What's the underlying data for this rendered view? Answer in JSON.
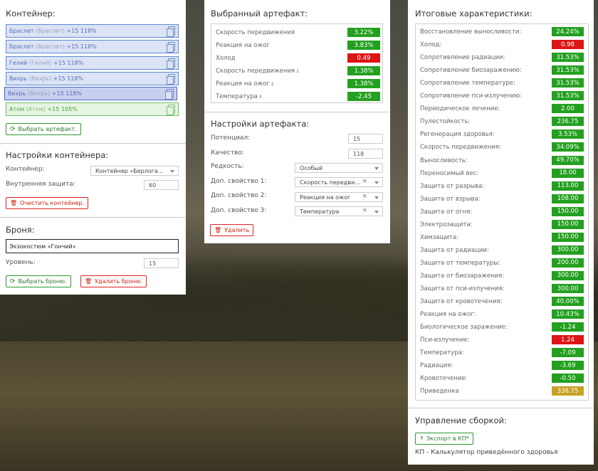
{
  "container": {
    "title": "Контейнер:",
    "items": [
      {
        "name": "Браслет",
        "alias": "(Браслет)",
        "bonus": "+15 118%"
      },
      {
        "name": "Браслет",
        "alias": "(Браслет)",
        "bonus": "+15 118%"
      },
      {
        "name": "Гелий",
        "alias": "(Гелий)",
        "bonus": "+15 118%"
      },
      {
        "name": "Вихрь",
        "alias": "(Вихрь)",
        "bonus": "+15 118%"
      },
      {
        "name": "Вихрь",
        "alias": "(Вихрь)",
        "bonus": "+15 118%"
      },
      {
        "name": "Атом",
        "alias": "(Атом)",
        "bonus": "+15 105%"
      }
    ],
    "choose_btn": "Выбрать артефакт."
  },
  "container_settings": {
    "title": "Настройки контейнера:",
    "container_label": "Контейнер:",
    "container_value": "Контейнер «Берлога...",
    "protection_label": "Внутренняя защита:",
    "protection_value": "60",
    "clear_btn": "Очистить контейнер."
  },
  "armor": {
    "title": "Броня:",
    "value": "Экзокостюм «Гончий»",
    "level_label": "Уровень:",
    "level_value": "15",
    "choose_btn": "Выбрать броню.",
    "delete_btn": "Удалить броню."
  },
  "selected": {
    "title": "Выбранный артефакт:",
    "rows": [
      {
        "label": "Скорость передвижения",
        "sup": "",
        "value": "3.22%",
        "color": "#23a01f"
      },
      {
        "label": "Реакция на ожог",
        "sup": "",
        "value": "3.83%",
        "color": "#23a01f"
      },
      {
        "label": "Холод",
        "sup": "",
        "value": "0.49",
        "color": "#dd1515"
      },
      {
        "label": "Скорость передвижения",
        "sup": "1",
        "value": "1.38%",
        "color": "#23a01f"
      },
      {
        "label": "Реакция на ожог",
        "sup": "2",
        "value": "1.38%",
        "color": "#23a01f"
      },
      {
        "label": "Температура",
        "sup": "3",
        "value": "-2.45",
        "color": "#23a01f"
      }
    ]
  },
  "art_settings": {
    "title": "Настройки артефакта:",
    "potential_label": "Потенциал:",
    "potential_value": "15",
    "quality_label": "Качество:",
    "quality_value": "118",
    "rarity_label": "Редкость:",
    "rarity_value": "Особый",
    "prop1_label": "Доп. свойство 1:",
    "prop1_value": "Скорость передви...",
    "prop2_label": "Доп. свойство 2:",
    "prop2_value": "Реакция на ожог",
    "prop3_label": "Доп. свойство 3:",
    "prop3_value": "Температура",
    "delete_btn": "Удалить"
  },
  "totals": {
    "title": "Итоговые характеристики:",
    "rows": [
      {
        "label": "Восстановление выносливости:",
        "value": "24.24%",
        "color": "#23a01f"
      },
      {
        "label": "Холод:",
        "value": "0.98",
        "color": "#dd1515"
      },
      {
        "label": "Сопротивление радиации:",
        "value": "31.53%",
        "color": "#23a01f"
      },
      {
        "label": "Сопротивление биозаражению:",
        "value": "31.53%",
        "color": "#23a01f"
      },
      {
        "label": "Сопротивление температуре:",
        "value": "31.53%",
        "color": "#23a01f"
      },
      {
        "label": "Сопротивление пси-излучению:",
        "value": "31.53%",
        "color": "#23a01f"
      },
      {
        "label": "Периодическое лечение:",
        "value": "2.00",
        "color": "#23a01f"
      },
      {
        "label": "Пулестойкость:",
        "value": "236.75",
        "color": "#23a01f"
      },
      {
        "label": "Регенерация здоровья:",
        "value": "3.53%",
        "color": "#23a01f"
      },
      {
        "label": "Скорость передвижения:",
        "value": "34.09%",
        "color": "#23a01f"
      },
      {
        "label": "Выносливость:",
        "value": "49.70%",
        "color": "#23a01f"
      },
      {
        "label": "Переносимый вес:",
        "value": "18.00",
        "color": "#23a01f"
      },
      {
        "label": "Защита от разрыва:",
        "value": "113.00",
        "color": "#23a01f"
      },
      {
        "label": "Защита от взрыва:",
        "value": "108.00",
        "color": "#23a01f"
      },
      {
        "label": "Защита от огня:",
        "value": "150.00",
        "color": "#23a01f"
      },
      {
        "label": "Электрозащита:",
        "value": "150.00",
        "color": "#23a01f"
      },
      {
        "label": "Химзащита:",
        "value": "150.00",
        "color": "#23a01f"
      },
      {
        "label": "Защита от радиации:",
        "value": "300.00",
        "color": "#23a01f"
      },
      {
        "label": "Защита от температуры:",
        "value": "200.00",
        "color": "#23a01f"
      },
      {
        "label": "Защита от биозаражения:",
        "value": "300.00",
        "color": "#23a01f"
      },
      {
        "label": "Защита от пси-излучения:",
        "value": "300.00",
        "color": "#23a01f"
      },
      {
        "label": "Защита от кровотечения:",
        "value": "40.00%",
        "color": "#23a01f"
      },
      {
        "label": "Реакция на ожог:",
        "value": "10.43%",
        "color": "#23a01f"
      },
      {
        "label": "Биологическое заражение:",
        "value": "-1.24",
        "color": "#23a01f"
      },
      {
        "label": "Пси-излучение:",
        "value": "1.24",
        "color": "#dd1515"
      },
      {
        "label": "Температура:",
        "value": "-7.09",
        "color": "#23a01f"
      },
      {
        "label": "Радиация:",
        "value": "-3.69",
        "color": "#23a01f"
      },
      {
        "label": "Кровотечение:",
        "value": "-0.50",
        "color": "#23a01f"
      },
      {
        "label": "Приведенка",
        "value": "336.75",
        "color": "#c7a224"
      }
    ]
  },
  "build": {
    "title": "Управление сборкой:",
    "export_btn": "Экспорт в КП*",
    "footnote": "КП - Калькулятор приведённого здоровья"
  }
}
